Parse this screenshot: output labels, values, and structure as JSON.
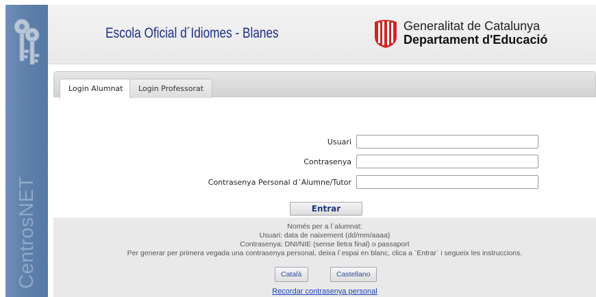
{
  "sidebar": {
    "brand": "CentrosNET",
    "icon": "keys-icon"
  },
  "header": {
    "school_name": "Escola Oficial d´Idiomes - Blanes",
    "gov_line1": "Generalitat de Catalunya",
    "gov_line2": "Departament d'Educació",
    "gov_logo": "generalitat-logo"
  },
  "tabs": [
    {
      "label": "Login Alumnat",
      "active": true
    },
    {
      "label": "Login Professorat",
      "active": false
    }
  ],
  "form": {
    "user_label": "Usuari",
    "user_value": "",
    "password_label": "Contrasenya",
    "password_value": "",
    "personal_label": "Contrasenya Personal d´Alumne/Tutor",
    "personal_value": "",
    "submit_label": "Entrar"
  },
  "info": {
    "line1": "Només per a l´alumnat:",
    "line2": "Usuari: data de naixement (dd/mm/aaaa)",
    "line3": "Contrasenya: DNI/NIE (sense lletra final) o passaport",
    "line4": "Per generar per primera vegada una contrasenya personal, deixa l´espai en blanc, clica a `Entrar´ i segueix les instruccions."
  },
  "languages": {
    "catala": "Català",
    "castellano": "Castellano"
  },
  "recover_link": "Recordar contrasenya personal",
  "colors": {
    "sidebar": "#5f80aa",
    "school_title": "#1d2f8a",
    "link": "#1a3fc0",
    "generalitat_red": "#d0261f"
  }
}
